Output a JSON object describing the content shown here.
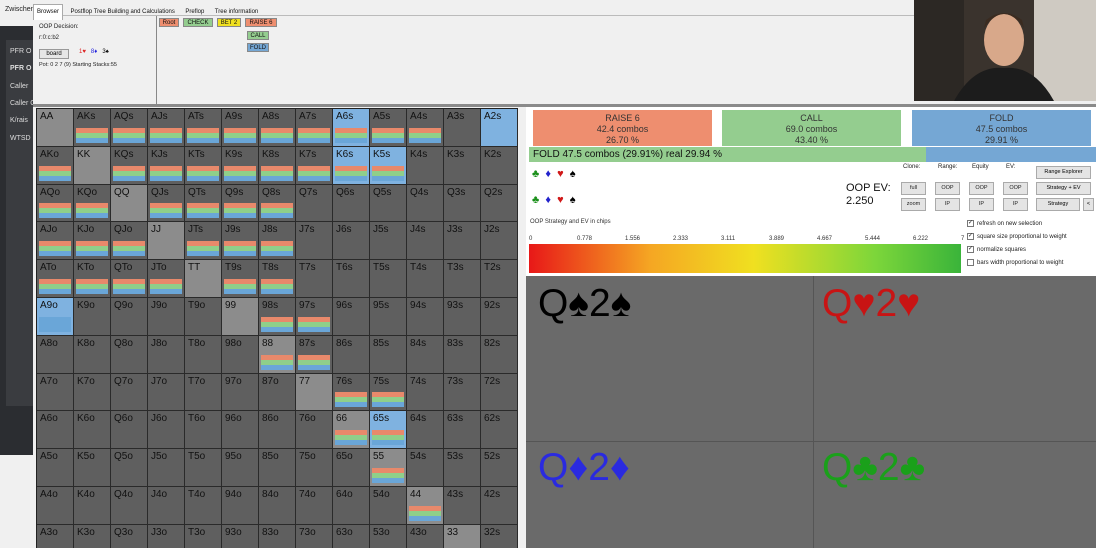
{
  "sidebar": {
    "top": "Zwischen",
    "items": [
      "PFR O",
      "PFR O",
      "Caller",
      "Caller C",
      "K/rais",
      "WTSD"
    ]
  },
  "tabs": [
    "Browser",
    "Postflop Tree Building and Calculations",
    "Preflop",
    "Tree information"
  ],
  "decision": {
    "title": "OOP Decision:",
    "line": "r:0:c:b2",
    "board_button": "board",
    "board_cards": [
      {
        "t": "1♥",
        "c": "r"
      },
      {
        "t": "8♦",
        "c": "b"
      },
      {
        "t": "3♠",
        "c": "k"
      }
    ],
    "pot": "Pot: 0 2 7 (9) Starting Stacks:55"
  },
  "tree": {
    "root": "Root",
    "check": "CHECK",
    "bet2": "BET 2",
    "raise6": "RAISE 6",
    "call": "CALL",
    "fold": "FOLD"
  },
  "grid": [
    [
      "AA",
      "AKs",
      "AQs",
      "AJs",
      "ATs",
      "A9s",
      "A8s",
      "A7s",
      "A6s",
      "A5s",
      "A4s",
      "A3s",
      "A2s"
    ],
    [
      "AKo",
      "KK",
      "KQs",
      "KJs",
      "KTs",
      "K9s",
      "K8s",
      "K7s",
      "K6s",
      "K5s",
      "K4s",
      "K3s",
      "K2s"
    ],
    [
      "AQo",
      "KQo",
      "QQ",
      "QJs",
      "QTs",
      "Q9s",
      "Q8s",
      "Q7s",
      "Q6s",
      "Q5s",
      "Q4s",
      "Q3s",
      "Q2s"
    ],
    [
      "AJo",
      "KJo",
      "QJo",
      "JJ",
      "JTs",
      "J9s",
      "J8s",
      "J7s",
      "J6s",
      "J5s",
      "J4s",
      "J3s",
      "J2s"
    ],
    [
      "ATo",
      "KTo",
      "QTo",
      "JTo",
      "TT",
      "T9s",
      "T8s",
      "T7s",
      "T6s",
      "T5s",
      "T4s",
      "T3s",
      "T2s"
    ],
    [
      "A9o",
      "K9o",
      "Q9o",
      "J9o",
      "T9o",
      "99",
      "98s",
      "97s",
      "96s",
      "95s",
      "94s",
      "93s",
      "92s"
    ],
    [
      "A8o",
      "K8o",
      "Q8o",
      "J8o",
      "T8o",
      "98o",
      "88",
      "87s",
      "86s",
      "85s",
      "84s",
      "83s",
      "82s"
    ],
    [
      "A7o",
      "K7o",
      "Q7o",
      "J7o",
      "T7o",
      "97o",
      "87o",
      "77",
      "76s",
      "75s",
      "74s",
      "73s",
      "72s"
    ],
    [
      "A6o",
      "K6o",
      "Q6o",
      "J6o",
      "T6o",
      "96o",
      "86o",
      "76o",
      "66",
      "65s",
      "64s",
      "63s",
      "62s"
    ],
    [
      "A5o",
      "K5o",
      "Q5o",
      "J5o",
      "T5o",
      "95o",
      "85o",
      "75o",
      "65o",
      "55",
      "54s",
      "53s",
      "52s"
    ],
    [
      "A4o",
      "K4o",
      "Q4o",
      "J4o",
      "T4o",
      "94o",
      "84o",
      "74o",
      "64o",
      "54o",
      "44",
      "43s",
      "42s"
    ],
    [
      "A3o",
      "K3o",
      "Q3o",
      "J3o",
      "T3o",
      "93o",
      "83o",
      "73o",
      "63o",
      "53o",
      "43o",
      "33",
      "32s"
    ]
  ],
  "actions": {
    "raise": {
      "name": "RAISE 6",
      "combos": "42.4 combos",
      "pct": "26.70 %"
    },
    "call": {
      "name": "CALL",
      "combos": "69.0 combos",
      "pct": "43.40 %"
    },
    "fold": {
      "name": "FOLD",
      "combos": "47.5 combos",
      "pct": "29.91 %"
    }
  },
  "foldbar": {
    "text": "FOLD  47.5 combos (29.91%) real  29.94 %",
    "fraction": 0.7
  },
  "ev": {
    "label": "OOP EV:",
    "value": "2.250"
  },
  "controls": {
    "clone": "Clone:",
    "range": "Range:",
    "equity": "Equity",
    "evh": "EV:",
    "full": "full",
    "zoom": "zoom",
    "oop": "OOP",
    "ip": "IP",
    "range_explorer": "Range Explorer",
    "strategy_ev": "Strategy + EV",
    "strategy": "Strategy",
    "arrow": "<"
  },
  "checks": [
    "refresh on new selection",
    "square size proportional to weight",
    "normalize squares",
    "bars width proportional to weight"
  ],
  "ev_title": "OOP Strategy and EV in chips",
  "scale": [
    "0",
    "0.778",
    "1.556",
    "2.333",
    "3.111",
    "3.889",
    "4.667",
    "5.444",
    "6.222",
    "7"
  ],
  "combos": [
    {
      "text": "Q♠2♠",
      "color": "#000000"
    },
    {
      "text": "Q♥2♥",
      "color": "#c81414"
    },
    {
      "text": "Q♦2♦",
      "color": "#2a2ae0"
    },
    {
      "text": "Q♣2♣",
      "color": "#1aa01a"
    }
  ]
}
